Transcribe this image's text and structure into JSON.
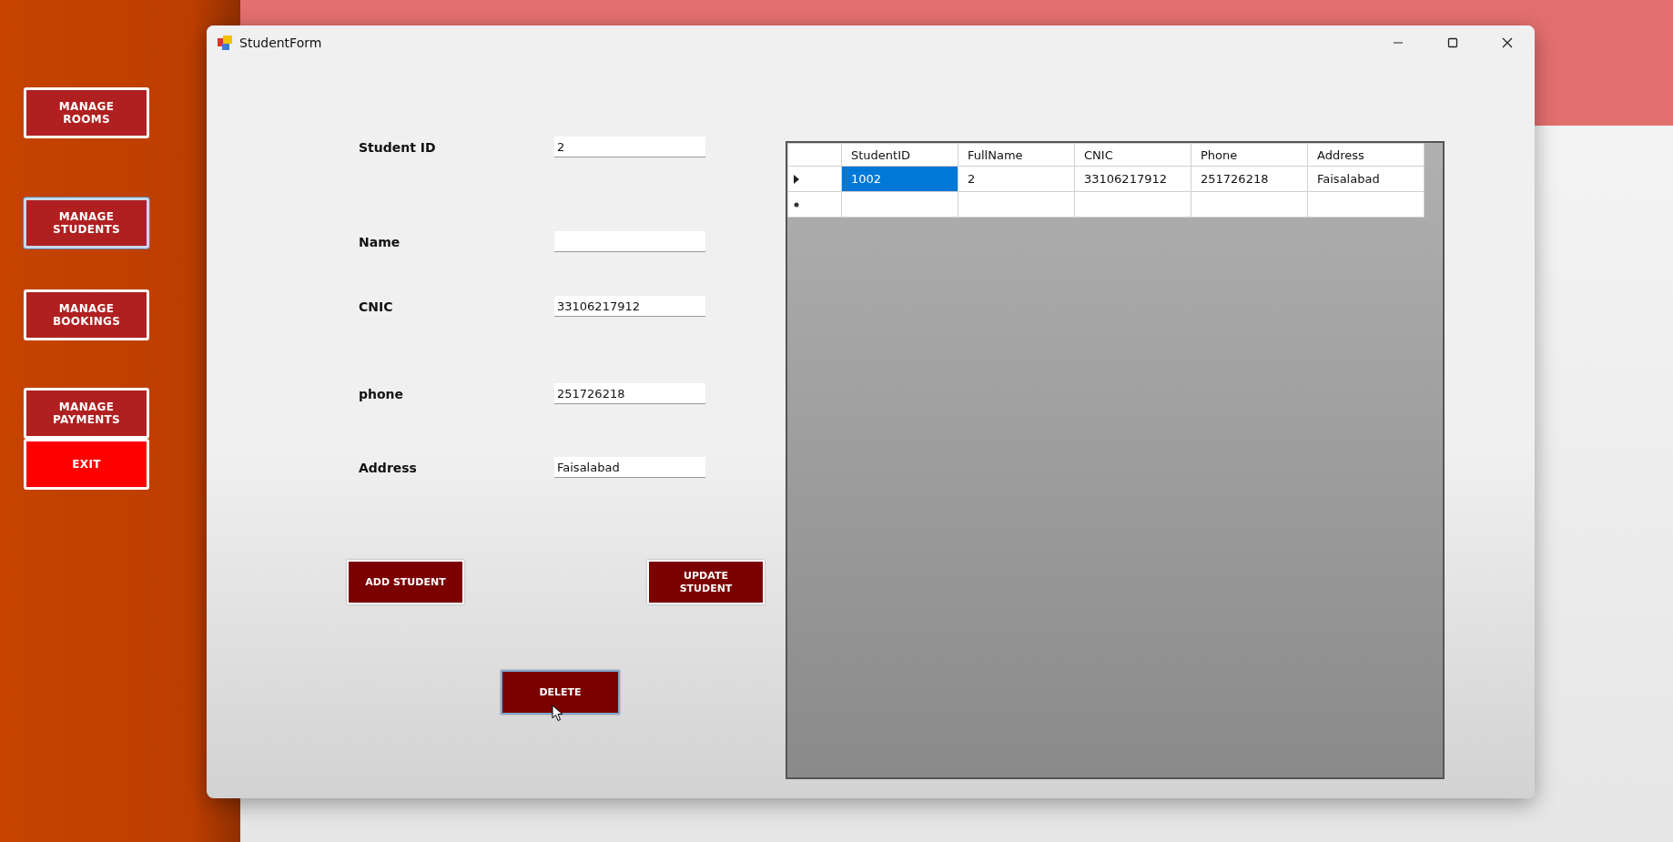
{
  "sidebar": {
    "buttons": [
      {
        "label": "MANAGE ROOMS",
        "kind": "normal",
        "focused": false
      },
      {
        "label": "MANAGE STUDENTS",
        "kind": "normal",
        "focused": true
      },
      {
        "label": "MANAGE BOOKINGS",
        "kind": "normal",
        "focused": false
      },
      {
        "label": "MANAGE PAYMENTS",
        "kind": "normal",
        "focused": false
      },
      {
        "label": "EXIT",
        "kind": "danger",
        "focused": false
      }
    ]
  },
  "window": {
    "title": "StudentForm"
  },
  "form": {
    "fields": [
      {
        "label": "Student ID",
        "value": "2"
      },
      {
        "label": "Name"
      },
      {
        "label": "CNIC",
        "value": "33106217912"
      },
      {
        "label": "phone",
        "value": "251726218"
      },
      {
        "label": "Address",
        "value": "Faisalabad"
      }
    ],
    "buttons": [
      {
        "label": "ADD STUDENT",
        "focused": false
      },
      {
        "label": "UPDATE STUDENT",
        "focused": false
      },
      {
        "label": "DELETE",
        "focused": true
      }
    ]
  },
  "table": {
    "columns": [
      "StudentID",
      "FullName",
      "CNIC",
      "Phone",
      "Address"
    ],
    "rows": [
      {
        "kind": "current",
        "cells": [
          {
            "text": "1002",
            "selected": true
          },
          {
            "text": "2",
            "selected": false
          },
          {
            "text": "33106217912",
            "selected": false
          },
          {
            "text": "251726218",
            "selected": false
          },
          {
            "text": "Faisalabad",
            "selected": false
          }
        ]
      },
      {
        "kind": "new"
      }
    ]
  }
}
